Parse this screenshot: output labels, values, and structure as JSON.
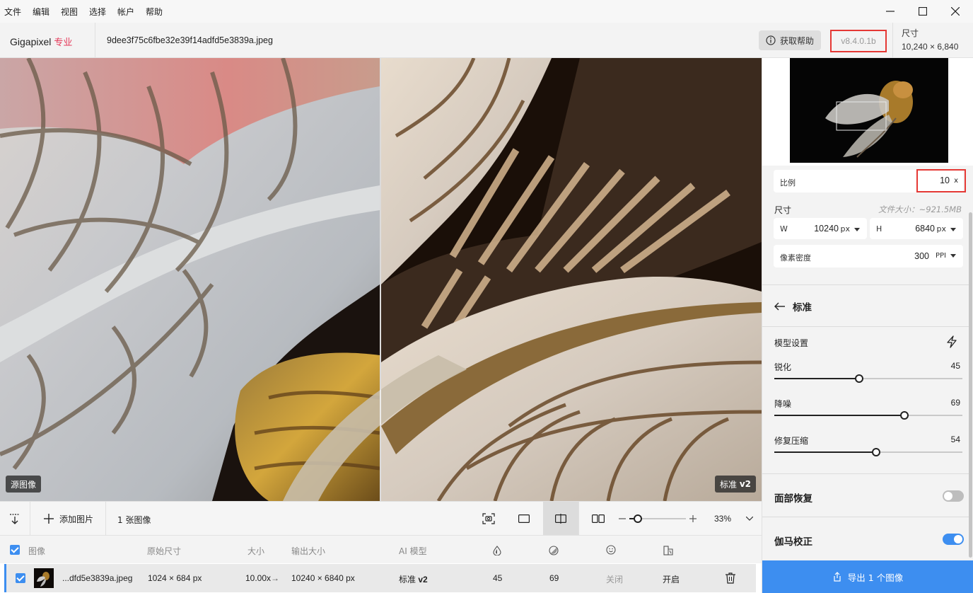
{
  "menu": [
    "文件",
    "编辑",
    "视图",
    "选择",
    "帐户",
    "帮助"
  ],
  "header": {
    "brand": "Gigapixel",
    "brand_edition": "专业",
    "filename": "9dee3f75c6fbe32e39f14adfd5e3839a.jpeg",
    "help_label": "获取帮助",
    "version": "v8.4.0.1b",
    "size_label": "尺寸",
    "size_value": "10,240 × 6,840"
  },
  "viewer": {
    "left_badge": "源图像",
    "right_badge_model": "标准",
    "right_badge_version": "v2"
  },
  "panel": {
    "scale_label": "比例",
    "scale_value": "10",
    "scale_unit": "x",
    "dims_label": "尺寸",
    "file_size": "文件大小：~921.5MB",
    "w_label": "W",
    "w_value": "10240",
    "w_unit": "px",
    "h_label": "H",
    "h_value": "6840",
    "h_unit": "px",
    "ppi_label": "像素密度",
    "ppi_value": "300",
    "ppi_unit": "PPI",
    "model_name": "标准",
    "model_settings_label": "模型设置",
    "sliders": [
      {
        "label": "锐化",
        "value": "45",
        "fraction": 0.45
      },
      {
        "label": "降噪",
        "value": "69",
        "fraction": 0.69
      },
      {
        "label": "修复压缩",
        "value": "54",
        "fraction": 0.54
      }
    ],
    "face_recovery_label": "面部恢复",
    "face_recovery_on": false,
    "gamma_label": "伽马校正",
    "gamma_on": true,
    "export_label": "导出 1 个图像"
  },
  "toolbar": {
    "add_images": "添加图片",
    "image_count": "1 张图像",
    "zoom": "33%",
    "zoom_fraction": 0.15
  },
  "list": {
    "headers": {
      "image": "图像",
      "orig_size": "原始尺寸",
      "scale": "大小",
      "output_size": "输出大小",
      "ai_model": "AI 模型"
    },
    "row": {
      "name": "...dfd5e3839a.jpeg",
      "orig_size": "1024 × 684 px",
      "scale": "10.00x",
      "output_size": "10240 × 6840 px",
      "model": "标准",
      "model_version": "v2",
      "sharpen": "45",
      "denoise": "69",
      "face": "关闭",
      "gamma": "开启"
    }
  },
  "colors": {
    "accent": "#3d8ef0",
    "brand_pro": "#e53a5a",
    "highlight_box": "#e53935"
  }
}
